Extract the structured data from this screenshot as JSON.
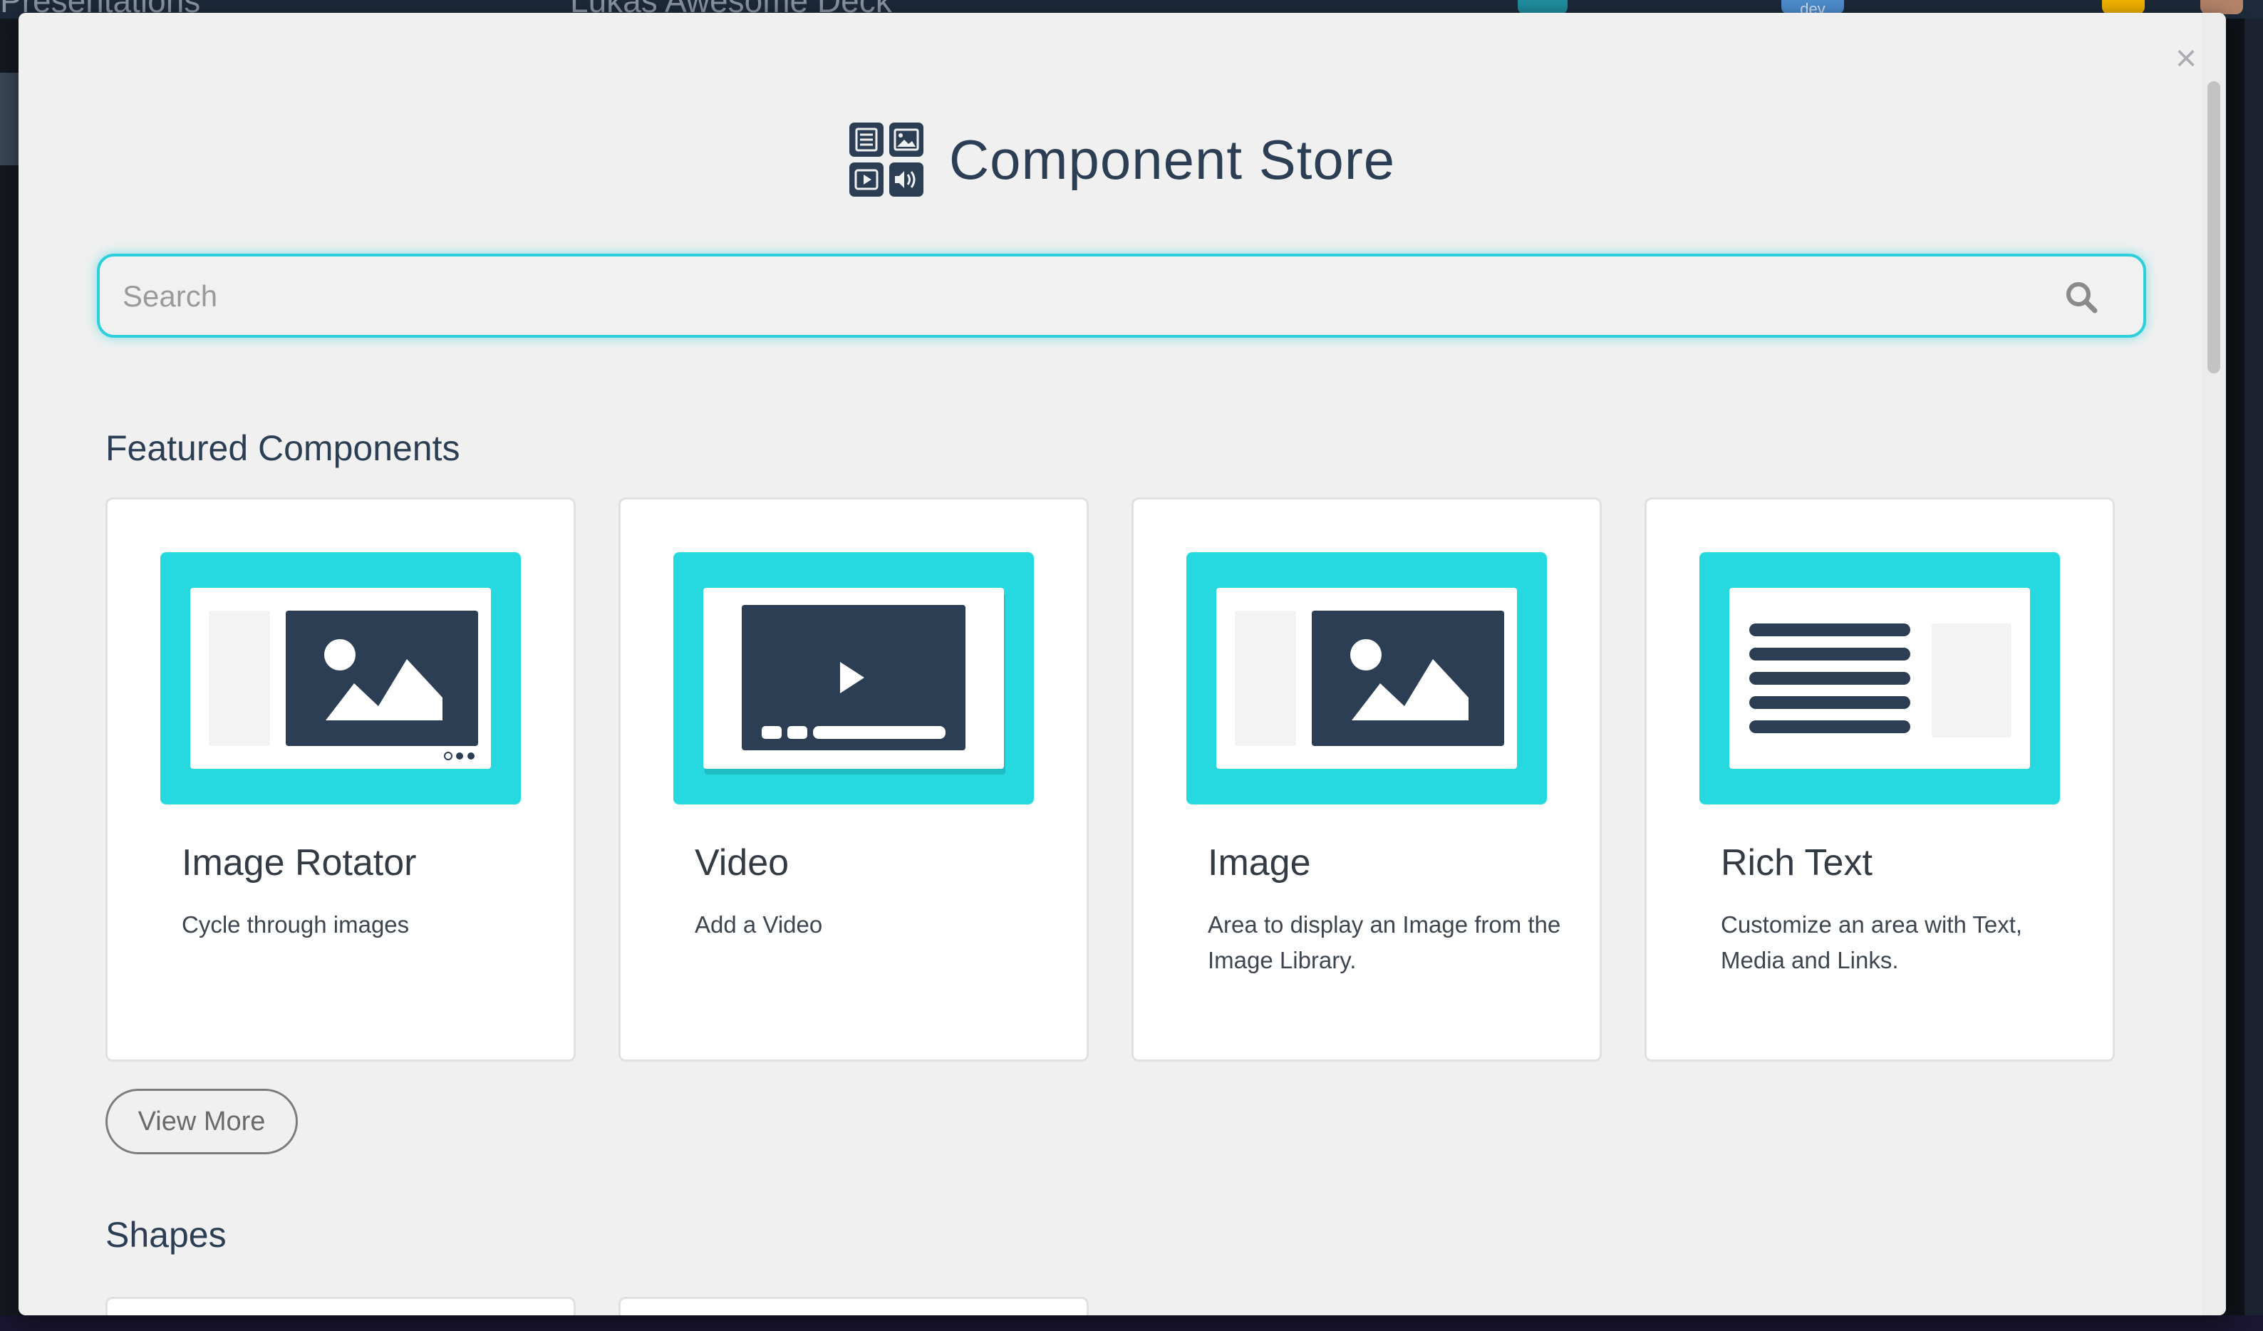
{
  "background_app": {
    "section_label": "Presentations",
    "deck_title": "Lukas Awesome Deck",
    "env_badge": "dev"
  },
  "modal": {
    "title": "Component Store",
    "close_label": "×",
    "search": {
      "placeholder": "Search",
      "value": ""
    },
    "featured": {
      "heading": "Featured Components",
      "cards": [
        {
          "title": "Image Rotator",
          "description": "Cycle through images",
          "icon": "image-rotator-thumbnail"
        },
        {
          "title": "Video",
          "description": "Add a Video",
          "icon": "video-thumbnail"
        },
        {
          "title": "Image",
          "description": "Area to display an Image from the Image Library.",
          "icon": "image-thumbnail"
        },
        {
          "title": "Rich Text",
          "description": "Customize an area with Text, Media and Links.",
          "icon": "rich-text-thumbnail"
        }
      ],
      "view_more_label": "View More"
    },
    "shapes": {
      "heading": "Shapes"
    }
  },
  "colors": {
    "accent": "#26d9e0",
    "navy": "#2c3e54",
    "modal_bg": "#f0f0f0",
    "card_bg": "#ffffff"
  }
}
